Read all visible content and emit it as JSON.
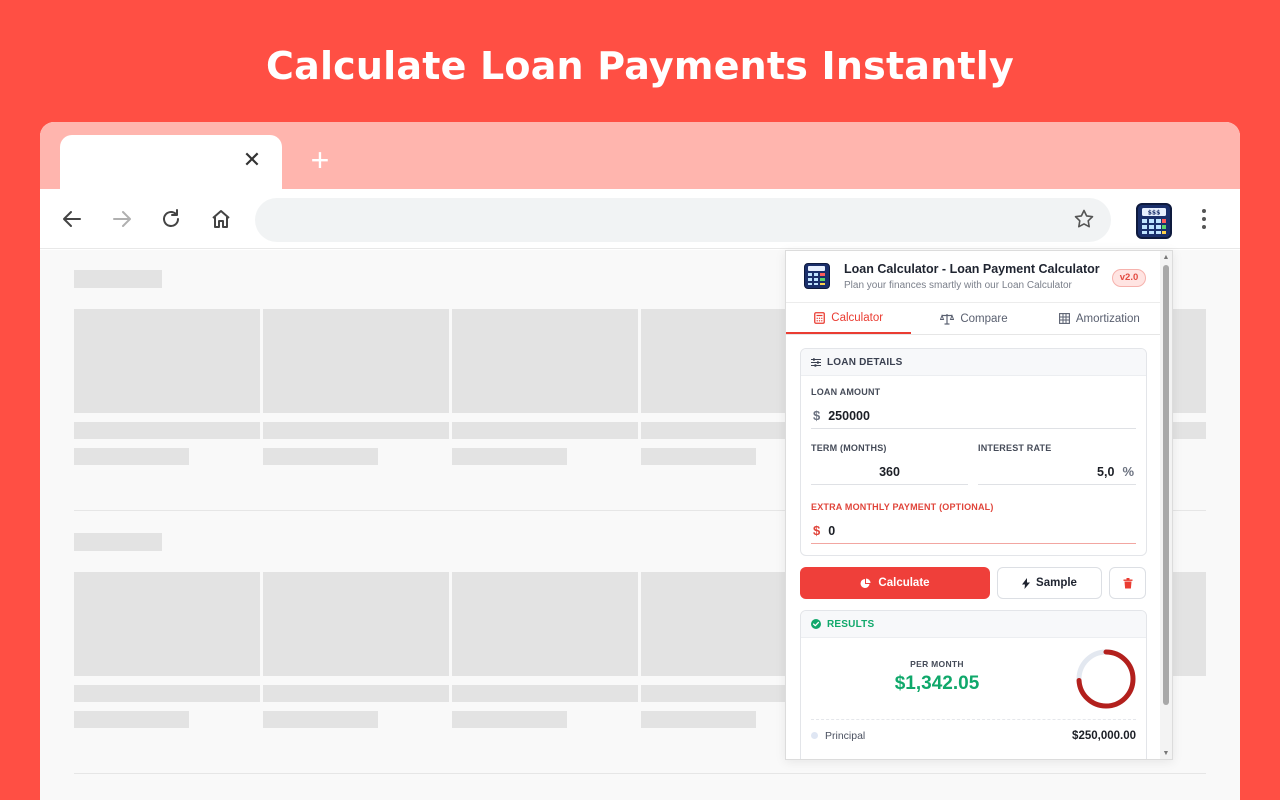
{
  "headline": "Calculate Loan Payments Instantly",
  "browser": {
    "tab_close": "✕",
    "new_tab": "+"
  },
  "icons": {
    "back": "arrow-left-icon",
    "forward": "arrow-right-icon",
    "reload": "reload-icon",
    "home": "home-icon",
    "bookmark": "star-icon",
    "extension": "calculator-icon",
    "menu": "more-vertical-icon"
  },
  "popup": {
    "title": "Loan Calculator - Loan Payment Calculator",
    "subtitle": "Plan your finances smartly with our Loan Calculator",
    "version": "v2.0",
    "tabs": [
      {
        "label": "Calculator",
        "icon": "calculator-icon",
        "active": true
      },
      {
        "label": "Compare",
        "icon": "scale-icon",
        "active": false
      },
      {
        "label": "Amortization",
        "icon": "table-icon",
        "active": false
      }
    ],
    "loan_details": {
      "header": "LOAN DETAILS",
      "loan_amount_label": "LOAN AMOUNT",
      "currency": "$",
      "loan_amount": "250000",
      "term_label": "TERM (MONTHS)",
      "term": "360",
      "rate_label": "INTEREST RATE",
      "rate": "5,0",
      "percent": "%",
      "extra_label": "EXTRA MONTHLY PAYMENT (OPTIONAL)",
      "extra": "0"
    },
    "buttons": {
      "calculate": "Calculate",
      "sample": "Sample"
    },
    "results": {
      "header": "RESULTS",
      "per_month_label": "PER MONTH",
      "per_month": "$1,342.05",
      "principal_share": 0.74,
      "principal_label": "Principal",
      "principal_value": "$250,000.00"
    }
  },
  "colors": {
    "background": "#ff4f44",
    "accent": "#ef3f3a",
    "success": "#10a86b"
  }
}
